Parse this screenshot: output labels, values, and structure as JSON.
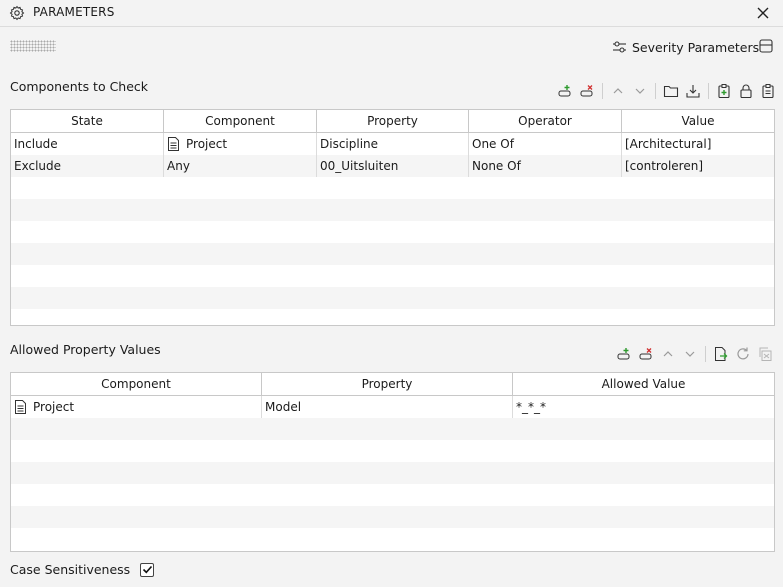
{
  "window": {
    "title": "PARAMETERS",
    "icon": "gear-icon",
    "close_icon": "close-icon"
  },
  "header": {
    "severity_label": "Severity Parameters",
    "severity_icon": "sliders-icon",
    "panel_icon": "panel-layout-icon"
  },
  "components": {
    "title": "Components to Check",
    "toolbar": [
      "add-row-icon",
      "remove-row-icon",
      "move-up-icon",
      "move-down-icon",
      "open-folder-icon",
      "download-icon",
      "add-clipboard-icon",
      "lock-icon",
      "clipboard-icon"
    ],
    "columns": [
      "State",
      "Component",
      "Property",
      "Operator",
      "Value"
    ],
    "rows": [
      {
        "state": "Include",
        "component": "Project",
        "component_icon": "document-icon",
        "property": "Discipline",
        "operator": "One Of",
        "value": "[Architectural]"
      },
      {
        "state": "Exclude",
        "component": "Any",
        "property": "00_Uitsluiten",
        "operator": "None Of",
        "value": "[controleren]"
      }
    ]
  },
  "allowed": {
    "title": "Allowed Property Values",
    "toolbar": [
      "add-row-icon",
      "remove-row-icon",
      "move-up-icon",
      "move-down-icon",
      "export-icon",
      "refresh-icon",
      "copy-disabled-icon"
    ],
    "columns": [
      "Component",
      "Property",
      "Allowed Value"
    ],
    "rows": [
      {
        "component": "Project",
        "component_icon": "document-icon",
        "property": "Model",
        "allowed_value": "*_*_*"
      }
    ]
  },
  "case_sensitiveness": {
    "label": "Case Sensitiveness",
    "checked": true
  }
}
